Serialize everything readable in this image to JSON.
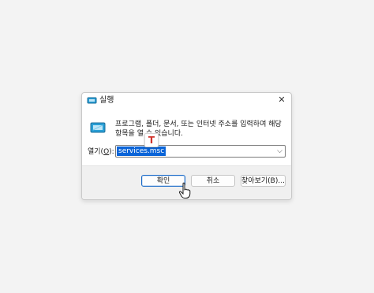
{
  "window": {
    "title": "실행",
    "close_glyph": "✕"
  },
  "description": "프로그램, 폴더, 문서, 또는 인터넷 주소를 입력하여 해당 항목을 열 수 있습니다.",
  "open_field": {
    "label_prefix": "열기(",
    "label_hotkey": "O",
    "label_suffix": "):",
    "value": "services.msc",
    "dropdown_glyph": "⌵"
  },
  "buttons": {
    "ok": "확인",
    "cancel": "취소",
    "browse": "찾아보기(B)..."
  },
  "ime_indicator": "T",
  "icons": [
    "run-icon",
    "close-icon",
    "run-large-icon",
    "chevron-down-icon",
    "mouse-pointer-icon"
  ],
  "colors": {
    "selection": "#0a64d8",
    "primary_border": "#1a6ac7",
    "ime_text": "#d0332b"
  }
}
